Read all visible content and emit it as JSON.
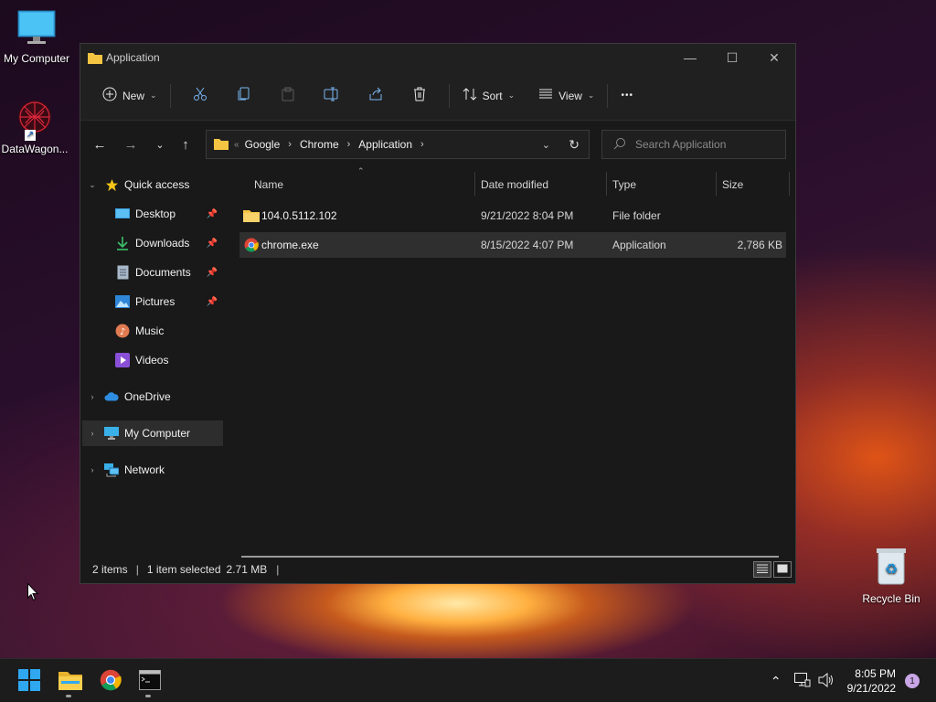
{
  "desktop": {
    "icons": [
      {
        "label": "My Computer"
      },
      {
        "label": "DataWagon..."
      },
      {
        "label": "Recycle Bin"
      }
    ]
  },
  "window": {
    "title": "Application",
    "controls": {
      "minimize": "—",
      "maximize": "☐",
      "close": "✕"
    }
  },
  "commandbar": {
    "new_label": "New",
    "sort_label": "Sort",
    "view_label": "View",
    "more_label": "•••",
    "icons": [
      "cut-icon",
      "copy-icon",
      "paste-icon",
      "rename-icon",
      "share-icon",
      "delete-icon"
    ]
  },
  "address": {
    "overflow": "«",
    "crumbs": [
      "Google",
      "Chrome",
      "Application"
    ],
    "search_placeholder": "Search Application"
  },
  "nav": {
    "quick_access": "Quick access",
    "quick_items": [
      {
        "label": "Desktop",
        "pinned": true
      },
      {
        "label": "Downloads",
        "pinned": true
      },
      {
        "label": "Documents",
        "pinned": true
      },
      {
        "label": "Pictures",
        "pinned": true
      },
      {
        "label": "Music",
        "pinned": false
      },
      {
        "label": "Videos",
        "pinned": false
      }
    ],
    "onedrive": "OneDrive",
    "my_computer": "My Computer",
    "network": "Network"
  },
  "columns": {
    "name": "Name",
    "date": "Date modified",
    "type": "Type",
    "size": "Size"
  },
  "files": [
    {
      "name": "104.0.5112.102",
      "date": "9/21/2022 8:04 PM",
      "type": "File folder",
      "size": "",
      "selected": false
    },
    {
      "name": "chrome.exe",
      "date": "8/15/2022 4:07 PM",
      "type": "Application",
      "size": "2,786 KB",
      "selected": true
    }
  ],
  "status": {
    "count": "2 items",
    "selection": "1 item selected",
    "size": "2.71 MB",
    "trailing": "|"
  },
  "taskbar": {
    "apps": [
      "start-icon",
      "file-explorer-icon",
      "chrome-icon",
      "terminal-icon"
    ],
    "time": "8:05 PM",
    "date": "9/21/2022",
    "notifications": "1"
  },
  "colors": {
    "accent": "#0078d4",
    "folder": "#f4c542",
    "window_bg": "#191919",
    "taskbar_bg": "#1c1c1c"
  }
}
